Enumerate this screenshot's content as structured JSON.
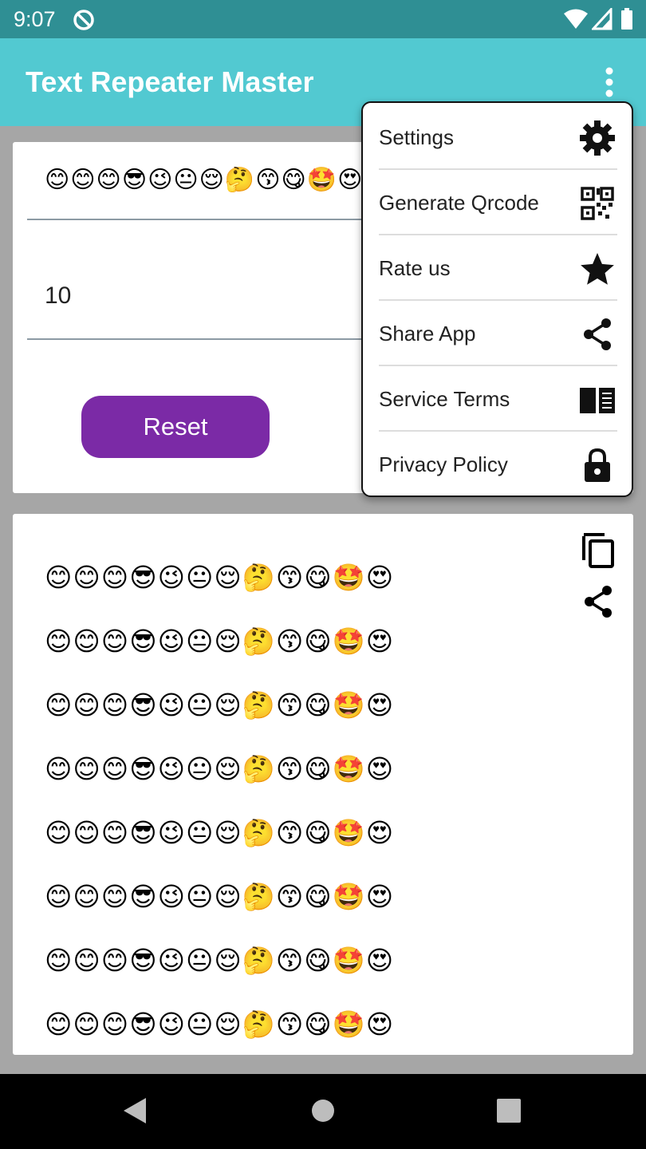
{
  "status_bar": {
    "time": "9:07"
  },
  "app_bar": {
    "title": "Text Repeater Master"
  },
  "input": {
    "text_value": "😊😊😊😎😉😐😌🤔😙😋🤩😍",
    "repeat_count": "10",
    "reset_label": "Reset"
  },
  "output": {
    "lines": [
      "😊😊😊😎😉😐😌🤔😙😋🤩😍",
      "😊😊😊😎😉😐😌🤔😙😋🤩😍",
      "😊😊😊😎😉😐😌🤔😙😋🤩😍",
      "😊😊😊😎😉😐😌🤔😙😋🤩😍",
      "😊😊😊😎😉😐😌🤔😙😋🤩😍",
      "😊😊😊😎😉😐😌🤔😙😋🤩😍",
      "😊😊😊😎😉😐😌🤔😙😋🤩😍",
      "😊😊😊😎😉😐😌🤔😙😋🤩😍"
    ]
  },
  "menu": {
    "items": [
      {
        "label": "Settings",
        "icon": "gear-icon"
      },
      {
        "label": "Generate Qrcode",
        "icon": "qrcode-icon"
      },
      {
        "label": "Rate us",
        "icon": "star-icon"
      },
      {
        "label": "Share App",
        "icon": "share-icon"
      },
      {
        "label": "Service Terms",
        "icon": "book-icon"
      },
      {
        "label": "Privacy Policy",
        "icon": "lock-icon"
      }
    ]
  },
  "colors": {
    "app_bar": "#52c9d1",
    "status_bar": "#2f8f94",
    "reset_button": "#7b2aa6",
    "background": "#a6a6a6"
  }
}
